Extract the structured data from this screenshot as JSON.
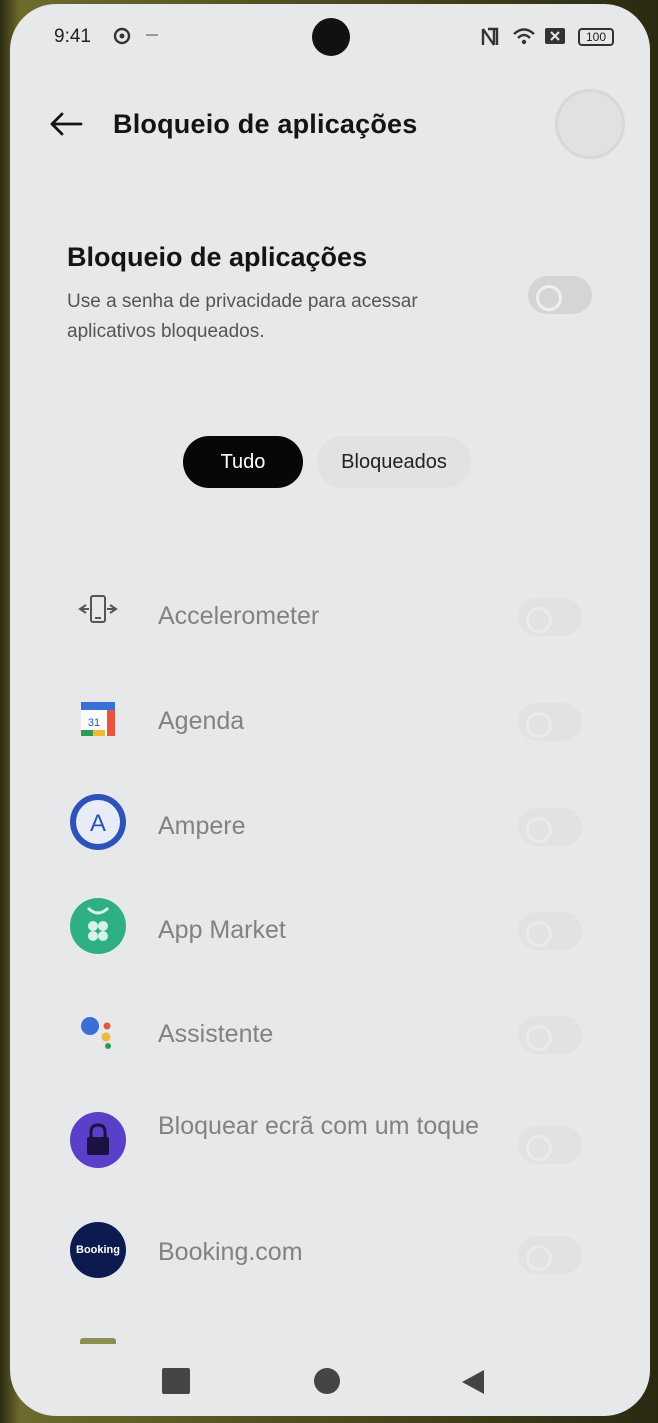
{
  "status_bar": {
    "time": "9:41",
    "battery": "100",
    "icons": [
      "settings-icon",
      "nfc-icon",
      "wifi-icon",
      "sim-icon",
      "battery-icon"
    ]
  },
  "header": {
    "title": "Bloqueio de aplicações",
    "back_icon": "arrow-left-icon"
  },
  "master": {
    "title": "Bloqueio de aplicações",
    "description": "Use a senha de privacidade para acessar aplicativos bloqueados.",
    "enabled": false
  },
  "tabs": [
    {
      "label": "Tudo",
      "active": true
    },
    {
      "label": "Bloqueados",
      "active": false
    }
  ],
  "apps": [
    {
      "label": "Accelerometer",
      "icon": "accelerometer-icon",
      "locked": false
    },
    {
      "label": "Agenda",
      "icon": "calendar-icon",
      "locked": false
    },
    {
      "label": "Ampere",
      "icon": "ampere-icon",
      "locked": false
    },
    {
      "label": "App Market",
      "icon": "app-market-icon",
      "locked": false
    },
    {
      "label": "Assistente",
      "icon": "assistant-icon",
      "locked": false
    },
    {
      "label": "Bloquear ecrã com um toque",
      "icon": "lock-screen-icon",
      "locked": false
    },
    {
      "label": "Booking.com",
      "icon": "booking-icon",
      "icon_text": "Booking",
      "locked": false
    }
  ],
  "navbar": {
    "icons": [
      "recents-icon",
      "home-icon",
      "back-icon"
    ]
  },
  "colors": {
    "background": "#e6e8e9",
    "tab_active": "#070707",
    "app_label": "#808284"
  }
}
